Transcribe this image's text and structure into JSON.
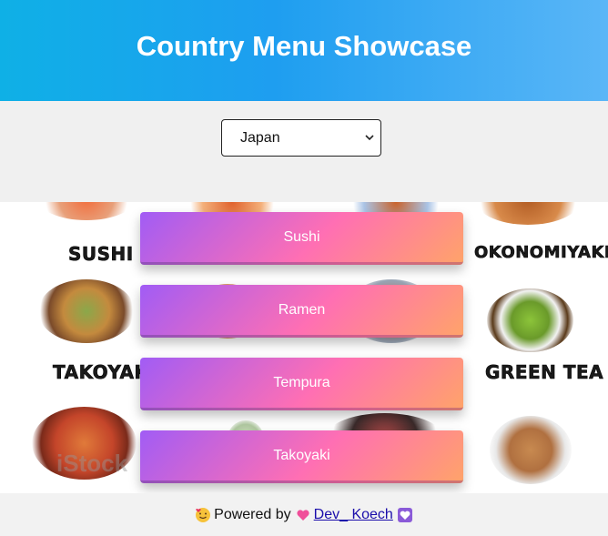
{
  "header": {
    "title": "Country Menu Showcase"
  },
  "country_select": {
    "selected": "Japan"
  },
  "banner": {
    "labels": [
      "SUSHI",
      "OKONOMIYAKI",
      "TAKOYAKI",
      "GREEN TEA"
    ],
    "watermark": "iStock"
  },
  "menu": {
    "items": [
      "Sushi",
      "Ramen",
      "Tempura",
      "Takoyaki"
    ]
  },
  "footer": {
    "powered_by": "Powered by",
    "author_link": "Dev_ Koech"
  },
  "colors": {
    "header_start": "#0fb0e6",
    "header_end": "#5ab6f7",
    "button_start": "#a15cf5",
    "button_mid": "#ff6fb3",
    "button_end": "#ffa36a"
  }
}
